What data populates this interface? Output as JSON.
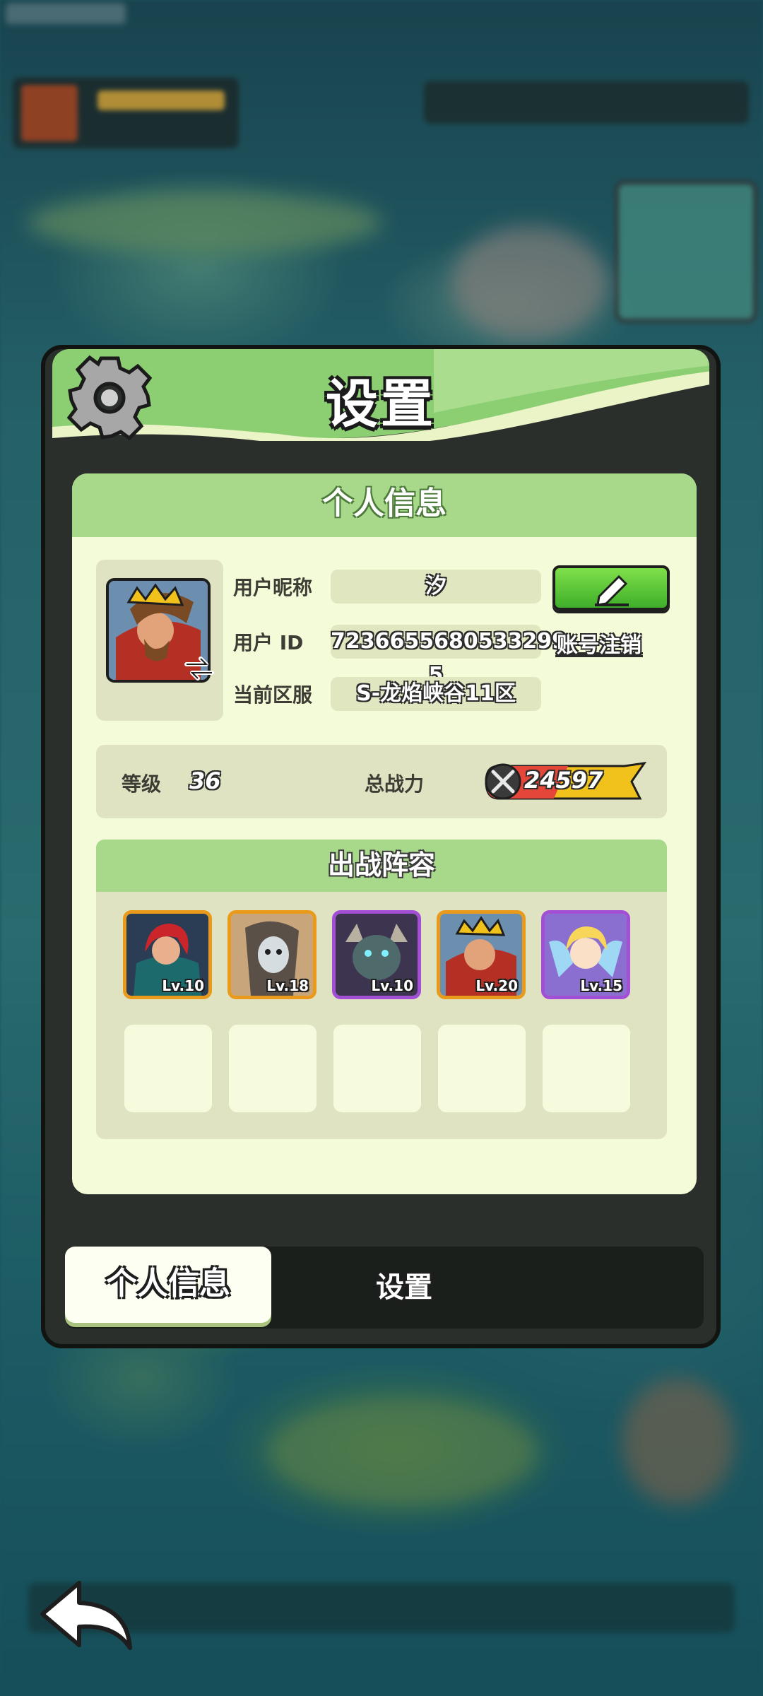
{
  "dialog": {
    "title": "设置",
    "section_title": "个人信息",
    "fields": {
      "nickname_label": "用户昵称",
      "nickname_value": "汐",
      "id_label": "用户 ID",
      "id_value": "7236655680533299​5",
      "server_label": "当前区服",
      "server_value": "S-龙焰峡谷11区"
    },
    "account_cancel_link": "账号注销",
    "level_label": "等级",
    "level_value": "36",
    "power_label": "总战力",
    "power_value": "24597",
    "team_title": "出战阵容",
    "heroes": [
      {
        "level": "Lv.10",
        "rarity": "orange"
      },
      {
        "level": "Lv.18",
        "rarity": "orange"
      },
      {
        "level": "Lv.10",
        "rarity": "purple"
      },
      {
        "level": "Lv.20",
        "rarity": "orange"
      },
      {
        "level": "Lv.15",
        "rarity": "purple"
      }
    ]
  },
  "tabs": {
    "personal_info": "个人信息",
    "settings": "设置"
  },
  "icons": {
    "gear": "gear-icon",
    "edit": "pencil-icon",
    "swap": "swap-icon",
    "power": "crossed-swords-icon",
    "back": "back-arrow-icon"
  },
  "colors": {
    "accent_green": "#a8d98a",
    "card_bg": "#f4fbd8",
    "edit_button": "#5cc83a",
    "orange_rarity": "#e99a1b",
    "purple_rarity": "#a24fd6"
  }
}
